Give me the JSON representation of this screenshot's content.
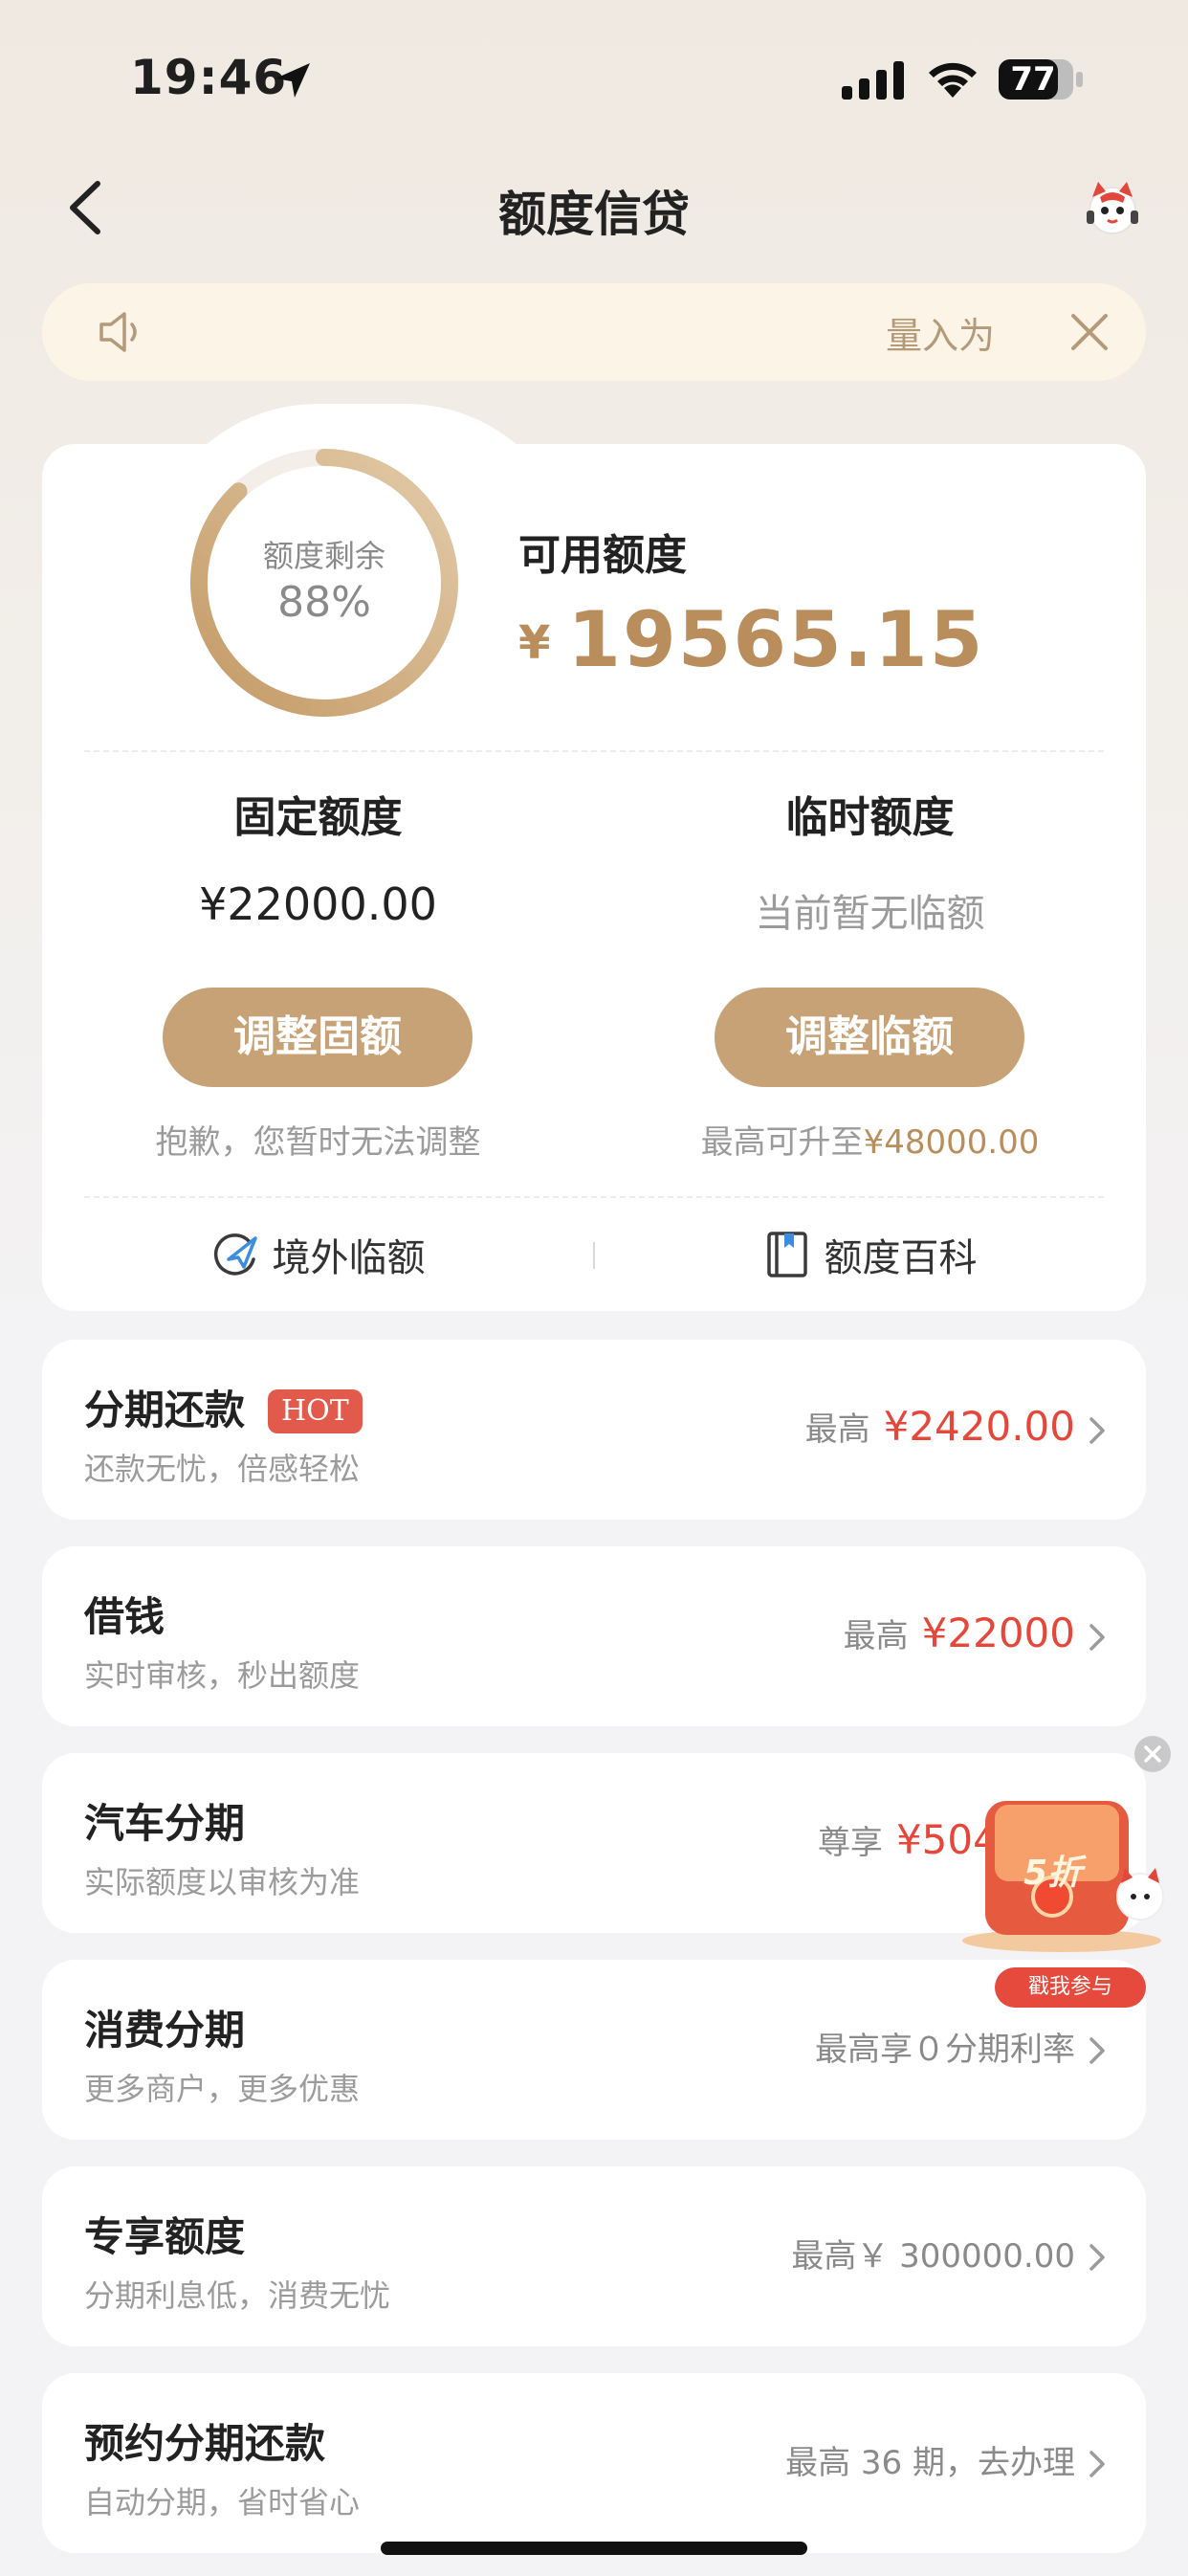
{
  "status_bar": {
    "time": "19:46",
    "battery": "77"
  },
  "nav": {
    "title": "额度信贷"
  },
  "notice": {
    "text": "量入为"
  },
  "credit": {
    "gauge_label": "额度剩余",
    "gauge_percent": "88%",
    "gauge_fraction": 0.88,
    "available_label": "可用额度",
    "available_currency": "¥",
    "available_amount": "19565.15",
    "fixed": {
      "title": "固定额度",
      "value": "¥22000.00",
      "button": "调整固额",
      "note": "抱歉，您暂时无法调整"
    },
    "temp": {
      "title": "临时额度",
      "value": "当前暂无临额",
      "button": "调整临额",
      "note_prefix": "最高可升至",
      "note_amount": "¥48000.00"
    },
    "links": {
      "overseas": "境外临额",
      "wiki": "额度百科"
    }
  },
  "services": [
    {
      "title": "分期还款",
      "badge": "HOT",
      "subtitle": "还款无忧，倍感轻松",
      "prefix": "最高",
      "amount": "¥2420.00"
    },
    {
      "title": "借钱",
      "subtitle": "实时审核，秒出额度",
      "prefix": "最高",
      "amount": "¥22000"
    },
    {
      "title": "汽车分期",
      "subtitle": "实际额度以审核为准",
      "prefix": "尊享",
      "amount": "¥504000"
    },
    {
      "title": "消费分期",
      "subtitle": "更多商户，更多优惠",
      "text": "最高享０分期利率"
    },
    {
      "title": "专享额度",
      "subtitle": "分期利息低，消费无忧",
      "text": "最高￥ 300000.00"
    },
    {
      "title": "预约分期还款",
      "subtitle": "自动分期，省时省心",
      "text": "最高 36 期，去办理"
    }
  ],
  "promo": {
    "discount": "5折",
    "button": "戳我参与"
  },
  "colors": {
    "accent": "#c8a277",
    "gold_text": "#b98e5c",
    "red": "#e5473b",
    "hot_badge": "#e25a4c"
  }
}
